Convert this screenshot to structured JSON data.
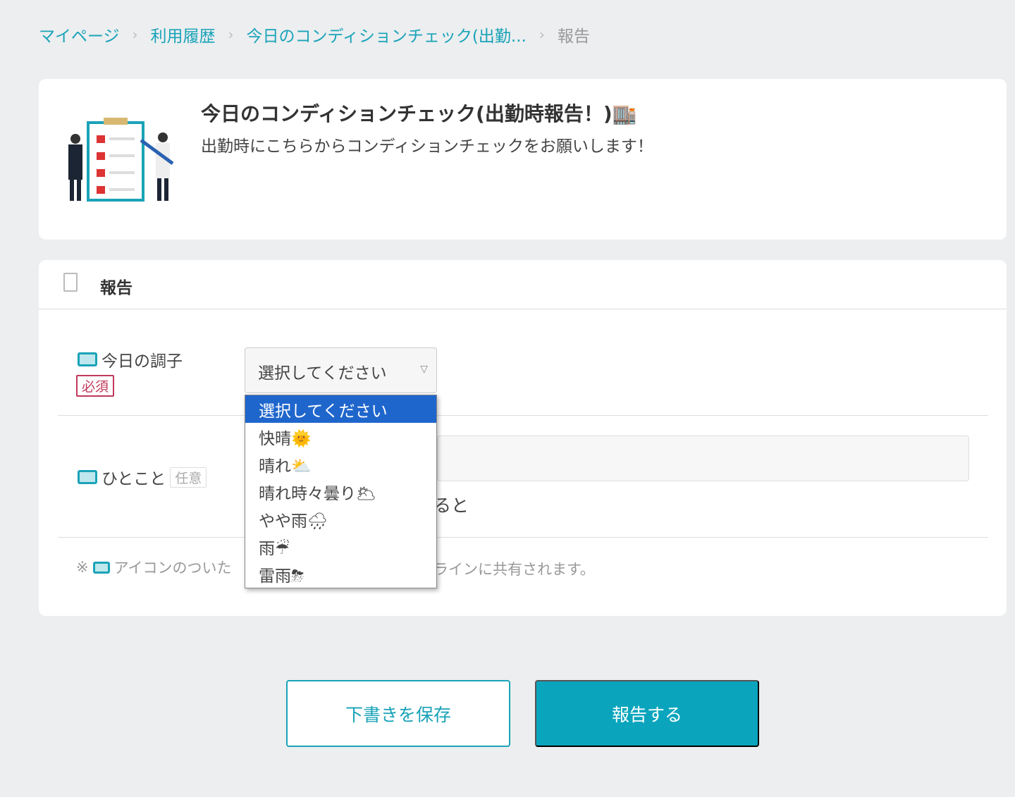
{
  "breadcrumb": [
    "マイページ",
    "利用履歴",
    "今日のコンディションチェック(出勤...",
    "報告"
  ],
  "header": {
    "title": "今日のコンディションチェック(出勤時報告！)🏬",
    "subtitle": "出勤時にこちらからコンディションチェックをお願いします！"
  },
  "section": {
    "title": "報告"
  },
  "fields": {
    "condition": {
      "label": "今日の調子",
      "badge": "必須",
      "selected": "選択してください",
      "options": [
        "選択してください",
        "快晴🌞",
        "晴れ⛅",
        "晴れ時々曇り🌥",
        "やや雨🌧",
        "雨☔",
        "雷雨⛈"
      ]
    },
    "comment": {
      "label": "ひとこと",
      "badge": "任意",
      "hint_fragment": "ると"
    }
  },
  "note": {
    "mark": "※",
    "part1": "アイコンのついた",
    "part2": "ラインに共有されます。"
  },
  "buttons": {
    "draft": "下書きを保存",
    "submit": "報告する"
  }
}
